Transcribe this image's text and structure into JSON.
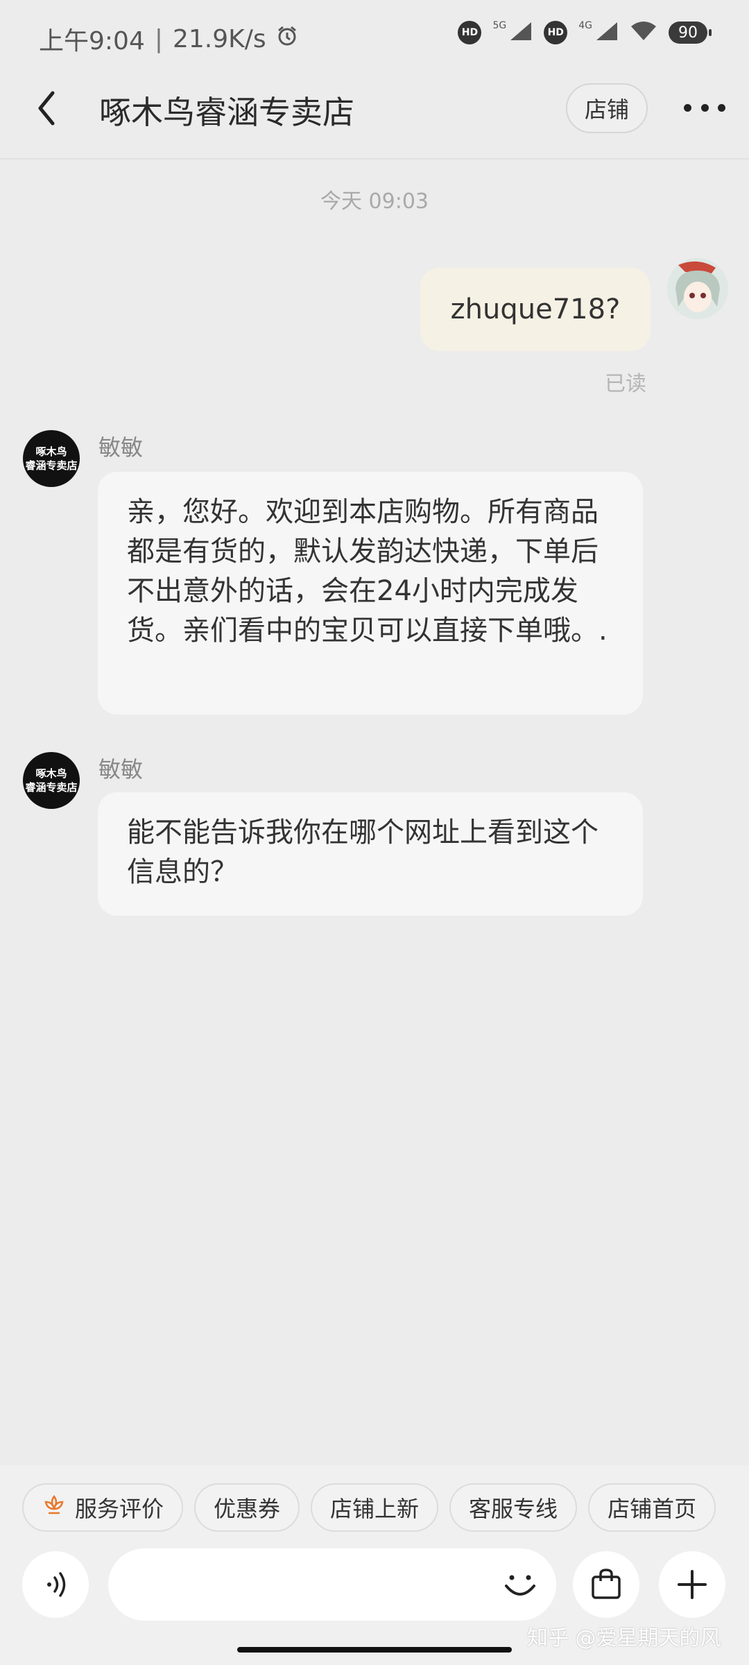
{
  "status_bar": {
    "time": "上午9:04",
    "speed": "21.9K/s",
    "net1": "5G",
    "net2": "4G",
    "hd": "HD",
    "battery": "90"
  },
  "nav": {
    "title": "啄木鸟睿涵专卖店",
    "shop_button": "店铺"
  },
  "chat": {
    "time_label": "今天  09:03",
    "my_message": "zhuque718?",
    "read_status": "已读",
    "shop_avatar_line1": "啄木鸟",
    "shop_avatar_line2": "睿涵专卖店",
    "messages": [
      {
        "sender": "敏敏",
        "text": "亲，您好。欢迎到本店购物。所有商品都是有货的，默认发韵达快递，下单后不出意外的话，会在24小时内完成发货。亲们看中的宝贝可以直接下单哦。."
      },
      {
        "sender": "敏敏",
        "text": "能不能告诉我你在哪个网址上看到这个信息的？"
      }
    ]
  },
  "quick_actions": [
    "服务评价",
    "优惠券",
    "店铺上新",
    "客服专线",
    "店铺首页"
  ],
  "watermark": "知乎 @爱星期天的风",
  "colors": {
    "accent_orange": "#e8782c",
    "my_bubble": "#f5f1e4",
    "shop_bubble": "#f6f6f6",
    "background": "#ececec"
  }
}
